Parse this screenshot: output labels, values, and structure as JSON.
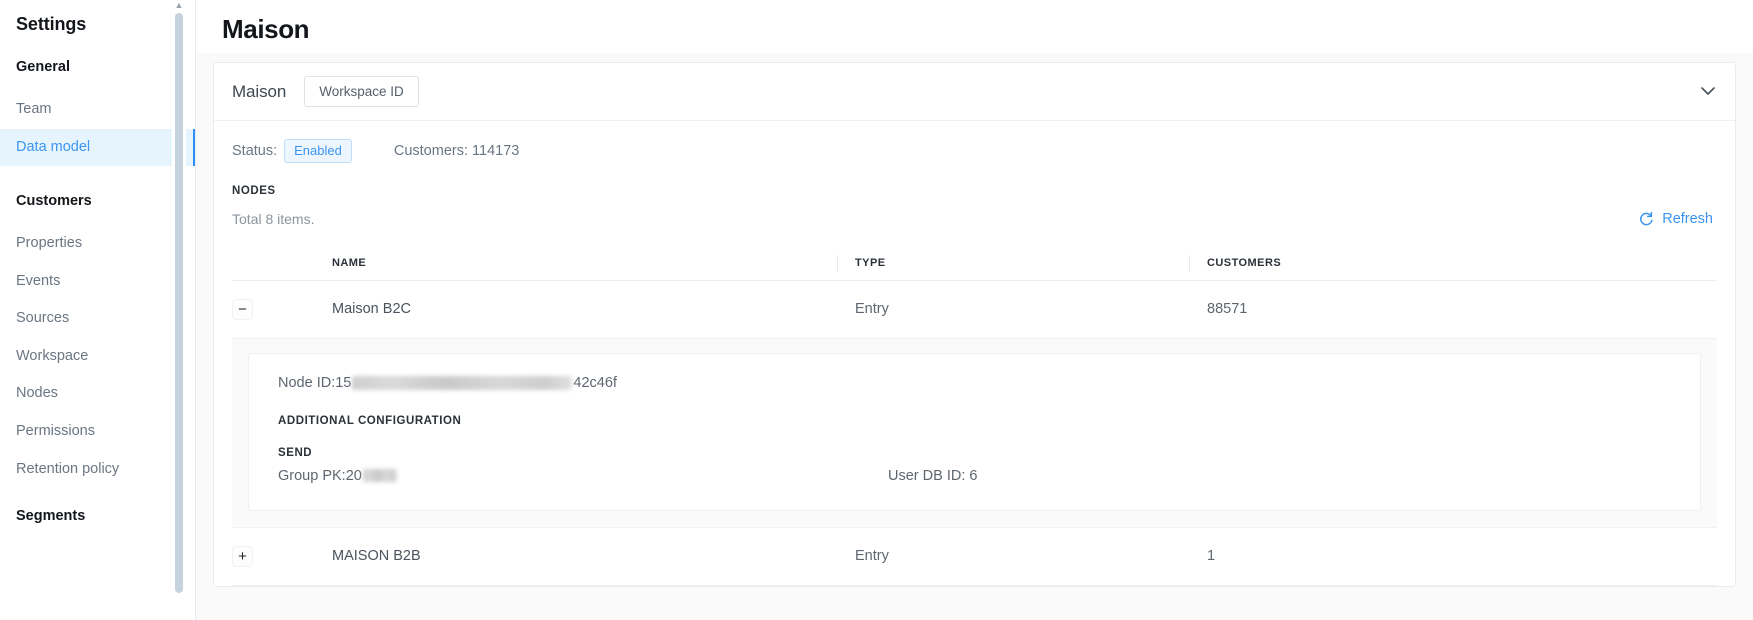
{
  "sidebar": {
    "title": "Settings",
    "groups": [
      {
        "label": "General",
        "items": [
          {
            "label": "Team",
            "active": false
          },
          {
            "label": "Data model",
            "active": true
          }
        ]
      },
      {
        "label": "Customers",
        "items": [
          {
            "label": "Properties",
            "active": false
          },
          {
            "label": "Events",
            "active": false
          },
          {
            "label": "Sources",
            "active": false
          },
          {
            "label": "Workspace",
            "active": false
          },
          {
            "label": "Nodes",
            "active": false
          },
          {
            "label": "Permissions",
            "active": false
          },
          {
            "label": "Retention policy",
            "active": false
          }
        ]
      },
      {
        "label": "Segments",
        "items": []
      }
    ]
  },
  "page": {
    "title": "Maison"
  },
  "card": {
    "name": "Maison",
    "workspace_id_button": "Workspace ID",
    "collapse_icon": "chevron-down-icon",
    "status_label": "Status:",
    "status_value": "Enabled",
    "customers_label": "Customers: 114173",
    "nodes_section_label": "NODES",
    "total_text": "Total 8 items.",
    "refresh_label": "Refresh",
    "refresh_icon": "refresh-icon"
  },
  "table": {
    "columns": [
      "NAME",
      "TYPE",
      "CUSTOMERS"
    ],
    "rows": [
      {
        "toggle": "−",
        "name": "Maison B2C",
        "type": "Entry",
        "customers": "88571",
        "expanded": true,
        "detail": {
          "node_id_label": "Node ID: ",
          "node_id_prefix": "15",
          "node_id_suffix": "42c46f",
          "additional_configuration_label": "ADDITIONAL CONFIGURATION",
          "send_label": "SEND",
          "group_pk_label": "Group PK: ",
          "group_pk_prefix": "20",
          "user_db_id": "User DB ID: 6"
        }
      },
      {
        "toggle": "+",
        "name": "MAISON B2B",
        "type": "Entry",
        "customers": "1",
        "expanded": false
      }
    ]
  },
  "colors": {
    "accent": "#3b95f1",
    "active_bg": "#e6f4fe",
    "text": "#5d666f",
    "heading": "#13161a",
    "page_bg": "#fafafa"
  }
}
